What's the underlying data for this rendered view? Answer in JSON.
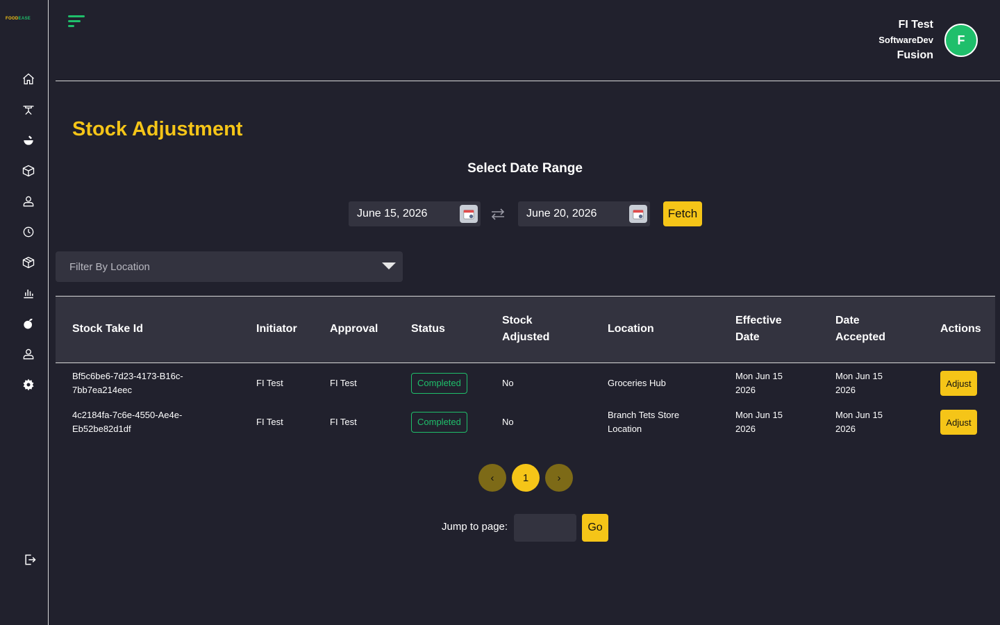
{
  "brand": {
    "part1": "FOOD",
    "part2": "EASE",
    "accent": "#f5c518",
    "green": "#1fbf6b"
  },
  "sidebar": {
    "icons": [
      "home-icon",
      "dining-table-icon",
      "food-icon",
      "box-icon",
      "user-icon",
      "clock-icon",
      "package-icon",
      "bar-chart-icon",
      "fruit-icon",
      "user-profile-icon",
      "gear-icon"
    ],
    "logout_icon": "logout-icon"
  },
  "user": {
    "name": "FI Test",
    "org": "SoftwareDev",
    "role": "Fusion",
    "initial": "F"
  },
  "page": {
    "title": "Stock Adjustment"
  },
  "date_range": {
    "title": "Select Date Range",
    "start": "June 15, 2026",
    "end": "June 20, 2026",
    "fetch_label": "Fetch"
  },
  "filter": {
    "placeholder": "Filter By Location"
  },
  "table": {
    "headers": {
      "id": "Stock Take Id",
      "initiator": "Initiator",
      "approval": "Approval",
      "status": "Status",
      "adjusted_line1": "Stock",
      "adjusted_line2": "Adjusted",
      "location": "Location",
      "effective_line1": "Effective",
      "effective_line2": "Date",
      "accepted_line1": "Date",
      "accepted_line2": "Accepted",
      "actions": "Actions"
    },
    "rows": [
      {
        "id_line1": "Bf5c6be6-7d23-4173-B16c-",
        "id_line2": "7bb7ea214eec",
        "initiator": "FI Test",
        "approval": "FI Test",
        "status": "Completed",
        "adjusted": "No",
        "location_line1": "Groceries Hub",
        "location_line2": "",
        "effective_line1": "Mon Jun 15",
        "effective_line2": "2026",
        "accepted_line1": "Mon Jun 15",
        "accepted_line2": "2026",
        "action": "Adjust"
      },
      {
        "id_line1": "4c2184fa-7c6e-4550-Ae4e-",
        "id_line2": "Eb52be82d1df",
        "initiator": "FI Test",
        "approval": "FI Test",
        "status": "Completed",
        "adjusted": "No",
        "location_line1": "Branch Tets Store",
        "location_line2": "Location",
        "effective_line1": "Mon Jun 15",
        "effective_line2": "2026",
        "accepted_line1": "Mon Jun 15",
        "accepted_line2": "2026",
        "action": "Adjust"
      }
    ]
  },
  "pagination": {
    "prev": "‹",
    "current": "1",
    "next": "›",
    "jump_label": "Jump to page:",
    "go_label": "Go"
  }
}
